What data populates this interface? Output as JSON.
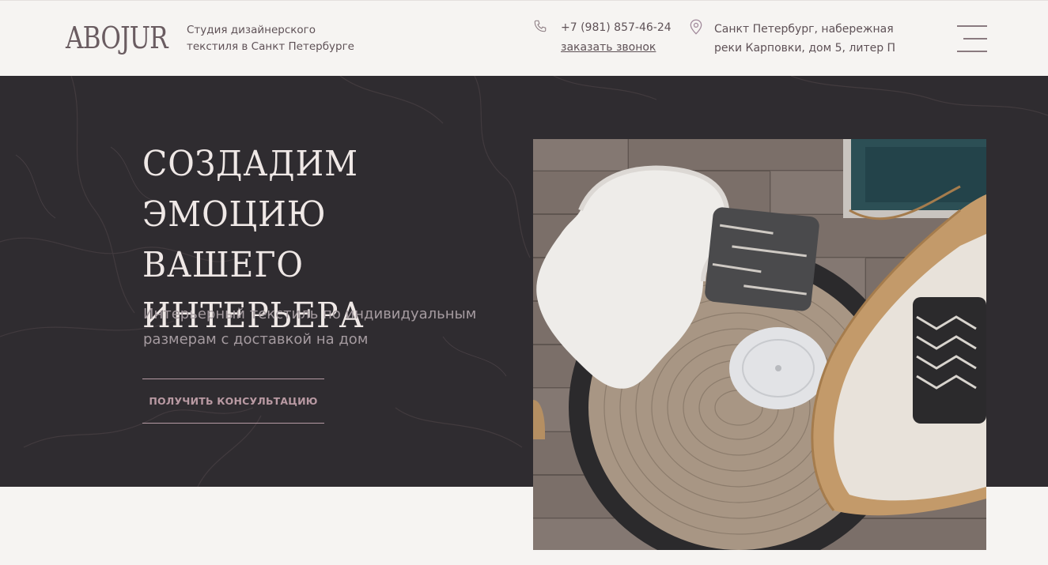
{
  "header": {
    "logo": "ABOJUR",
    "tagline_line1": "Студия дизайнерского",
    "tagline_line2": "текстиля в Санкт Петербурге",
    "phone": "+7 (981) 857-46-24",
    "callback_label": "заказать звонок",
    "address_line1": "Санкт Петербург, набережная",
    "address_line2": "реки Карповки, дом 5, литер П"
  },
  "hero": {
    "title_line1": "СОЗДАДИМ",
    "title_line2": "ЭМОЦИЮ ВАШЕГО",
    "title_line3": "ИНТЕРЬЕРА",
    "subtitle_line1": "Интерьерный текстиль по индивидуальным",
    "subtitle_line2": "размерам с доставкой на дом",
    "cta_label": "ПОЛУЧИТЬ КОНСУЛЬТАЦИЮ"
  },
  "colors": {
    "hero_bg": "#2f2c30",
    "accent": "#b99aa3",
    "page_bg": "#f6f4f2"
  },
  "icons": {
    "phone": "phone-icon",
    "location": "map-pin-icon",
    "menu": "hamburger-menu-icon"
  }
}
